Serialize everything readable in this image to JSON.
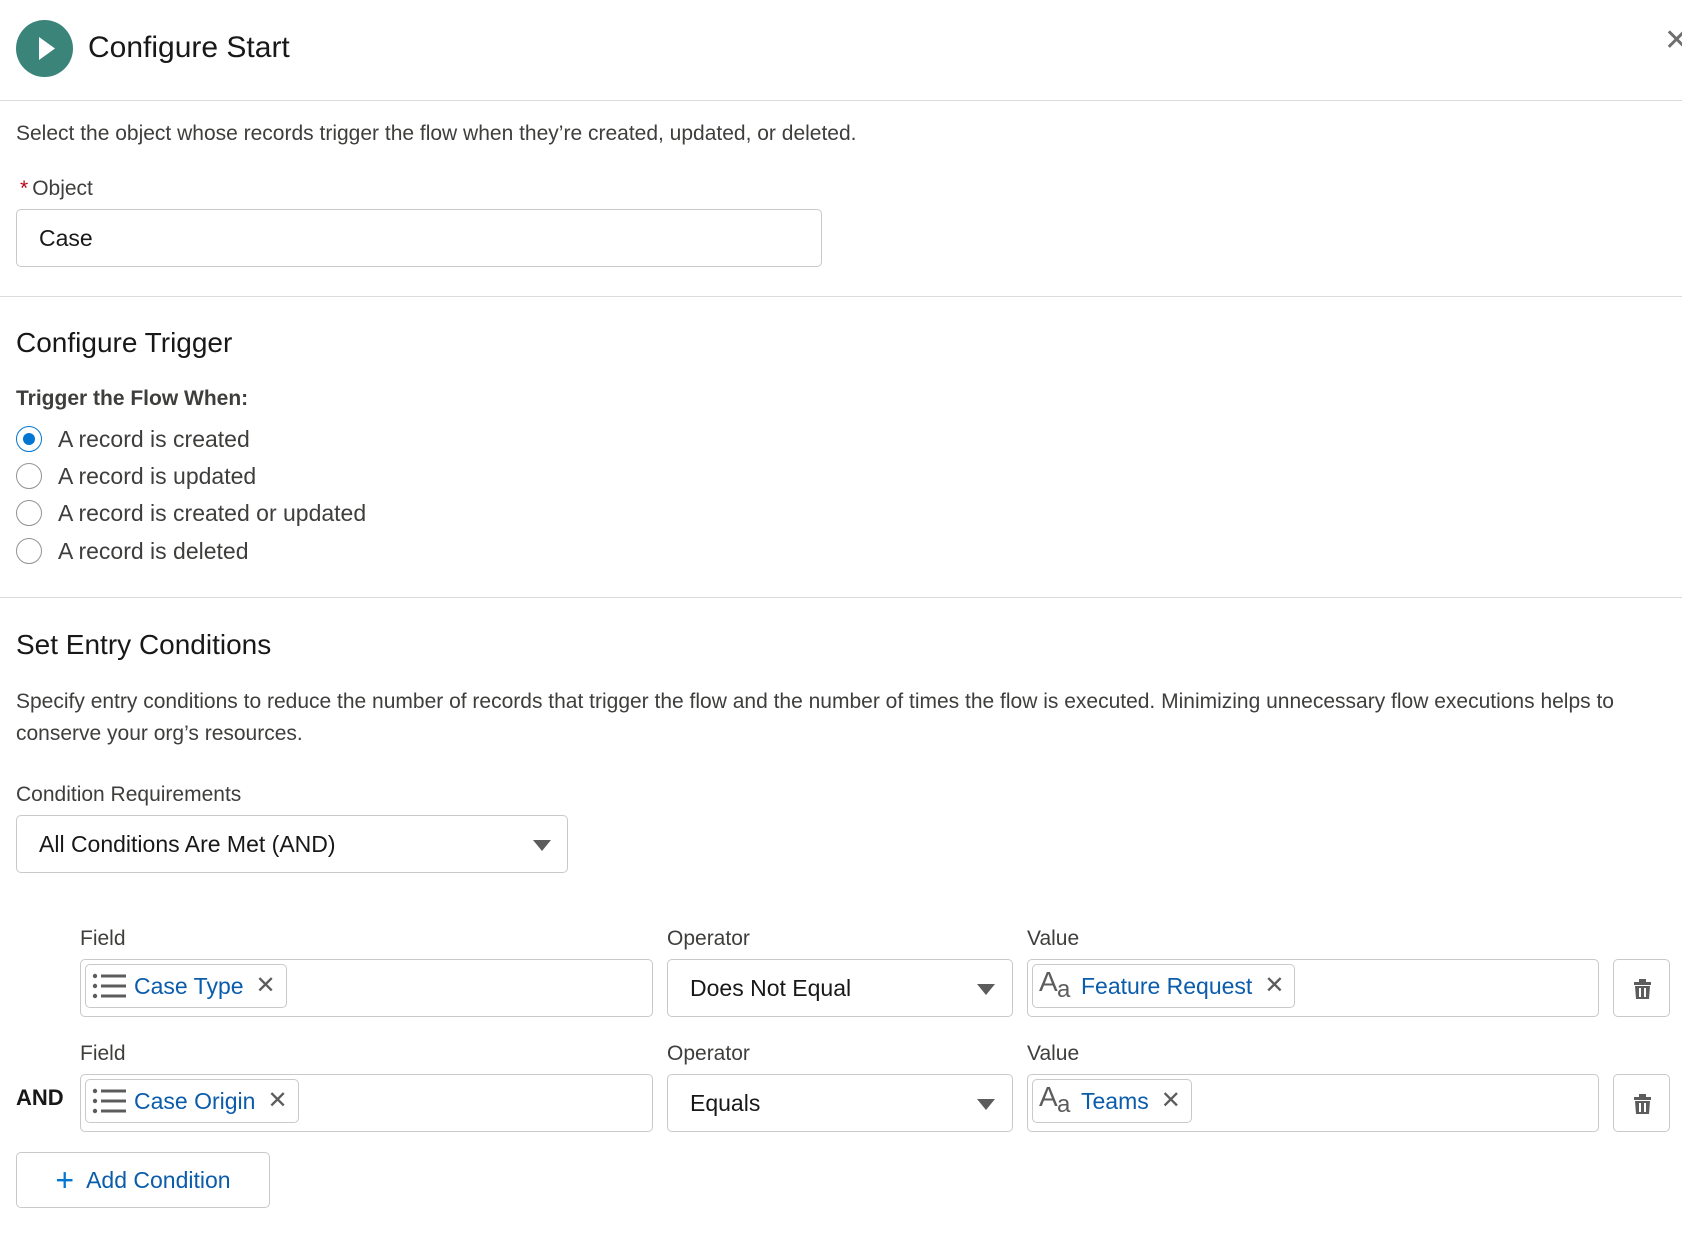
{
  "header": {
    "title": "Configure Start",
    "close_icon": "close-icon",
    "start_icon": "play-icon",
    "accent_color": "#3b847a"
  },
  "object_section": {
    "description": "Select the object whose records trigger the flow when they’re created, updated, or deleted.",
    "required_marker": "*",
    "object_label": "Object",
    "object_value": "Case"
  },
  "trigger_section": {
    "title": "Configure Trigger",
    "trigger_label": "Trigger the Flow When:",
    "options": [
      {
        "label": "A record is created",
        "checked": true
      },
      {
        "label": "A record is updated",
        "checked": false
      },
      {
        "label": "A record is created or updated",
        "checked": false
      },
      {
        "label": "A record is deleted",
        "checked": false
      }
    ]
  },
  "entry_section": {
    "title": "Set Entry Conditions",
    "description": "Specify entry conditions to reduce the number of records that trigger the flow and the number of times the flow is executed. Minimizing unnecessary flow executions helps to conserve your org’s resources.",
    "requirements_label": "Condition Requirements",
    "requirements_value": "All Conditions Are Met (AND)",
    "conditions": [
      {
        "connector": "",
        "field_label": "Field",
        "field_value": "Case Type",
        "operator_label": "Operator",
        "operator_value": "Does Not Equal",
        "value_label": "Value",
        "value_value": "Feature Request"
      },
      {
        "connector": "AND",
        "field_label": "Field",
        "field_value": "Case Origin",
        "operator_label": "Operator",
        "operator_value": "Equals",
        "value_label": "Value",
        "value_value": "Teams"
      }
    ],
    "add_condition_label": "Add Condition",
    "link_color": "#0b5cab",
    "brand_color": "#0176d3"
  }
}
